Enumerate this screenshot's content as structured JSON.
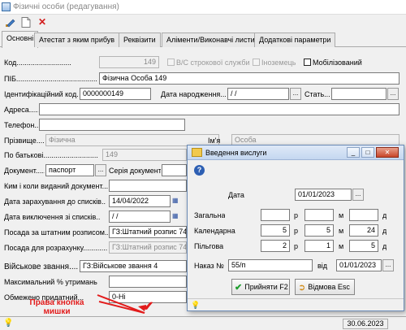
{
  "window": {
    "title": "Фізичні особи (редагування)"
  },
  "toolbar": {
    "edit_icon": "pencil-icon",
    "new_icon": "document-icon",
    "delete_icon": "red-x-icon"
  },
  "tabs": [
    "Основні",
    "Атестат з яким прибув",
    "Реквізити",
    "Аліменти/Виконавчі листи",
    "Додаткові параметри"
  ],
  "main": {
    "code_label": "Код",
    "code_value": "149",
    "military_service_label": "В/С строкової служби",
    "foreigner_label": "Іноземець",
    "mobilized_label": "Мобілізований",
    "name_label": "ПІБ",
    "name_value": "Фізична Особа 149",
    "tax_id_label": "Ідентифікаційний код",
    "tax_id_value": "0000000149",
    "birthdate_label": "Дата народження",
    "birthdate_value": " / /",
    "sex_label": "Стать",
    "address_label": "Адреса",
    "phone_label": "Телефон",
    "surname_label": "Прізвище",
    "surname_value": "Фізична",
    "firstname_label": "Ім'я",
    "firstname_value": "Особа",
    "patronymic_label": "По батькові",
    "patronymic_value": "149",
    "document_label": "Документ",
    "document_value": "паспорт",
    "doc_series_label": "Серія документа",
    "issued_by_label": "Ким і коли виданий документ",
    "enroll_date_label": "Дата зарахування до списків",
    "enroll_date_value": "14/04/2022",
    "exclude_date_label": "Дата виключення зі списків",
    "exclude_date_value": " / /",
    "staff_position_label": "Посада за штатним розписом",
    "staff_position_value": "ГЗ:Штатний розпис 74",
    "calc_position_label": "Посада для розрахунку",
    "calc_position_value": "ГЗ:Штатний розпис 74",
    "rank_label": "Військове звання",
    "rank_value": "ГЗ:Військове звання 4",
    "max_deduction_label": "Максимальний % утримань",
    "limited_fitness_label": "Обмежено придатний",
    "limited_fitness_value": "0-Ні",
    "annotation": "Права кнопка мишки",
    "status_date": "30.06.2023"
  },
  "dialog": {
    "title": "Введення вислуги",
    "date_label": "Дата",
    "date_value": "01/01/2023",
    "col_year": "р",
    "col_month": "м",
    "col_day": "д",
    "rows": [
      {
        "label": "Загальна",
        "years": "",
        "months": "",
        "days": ""
      },
      {
        "label": "Календарна",
        "years": "5",
        "months": "5",
        "days": "24"
      },
      {
        "label": "Пільгова",
        "years": "2",
        "months": "1",
        "days": "5"
      }
    ],
    "order_label": "Наказ №",
    "order_value": "55/п",
    "order_date_label": "від",
    "order_date_value": "01/01/2023",
    "accept_label": "Прийняти F2",
    "cancel_label": "Відмова Esc"
  }
}
